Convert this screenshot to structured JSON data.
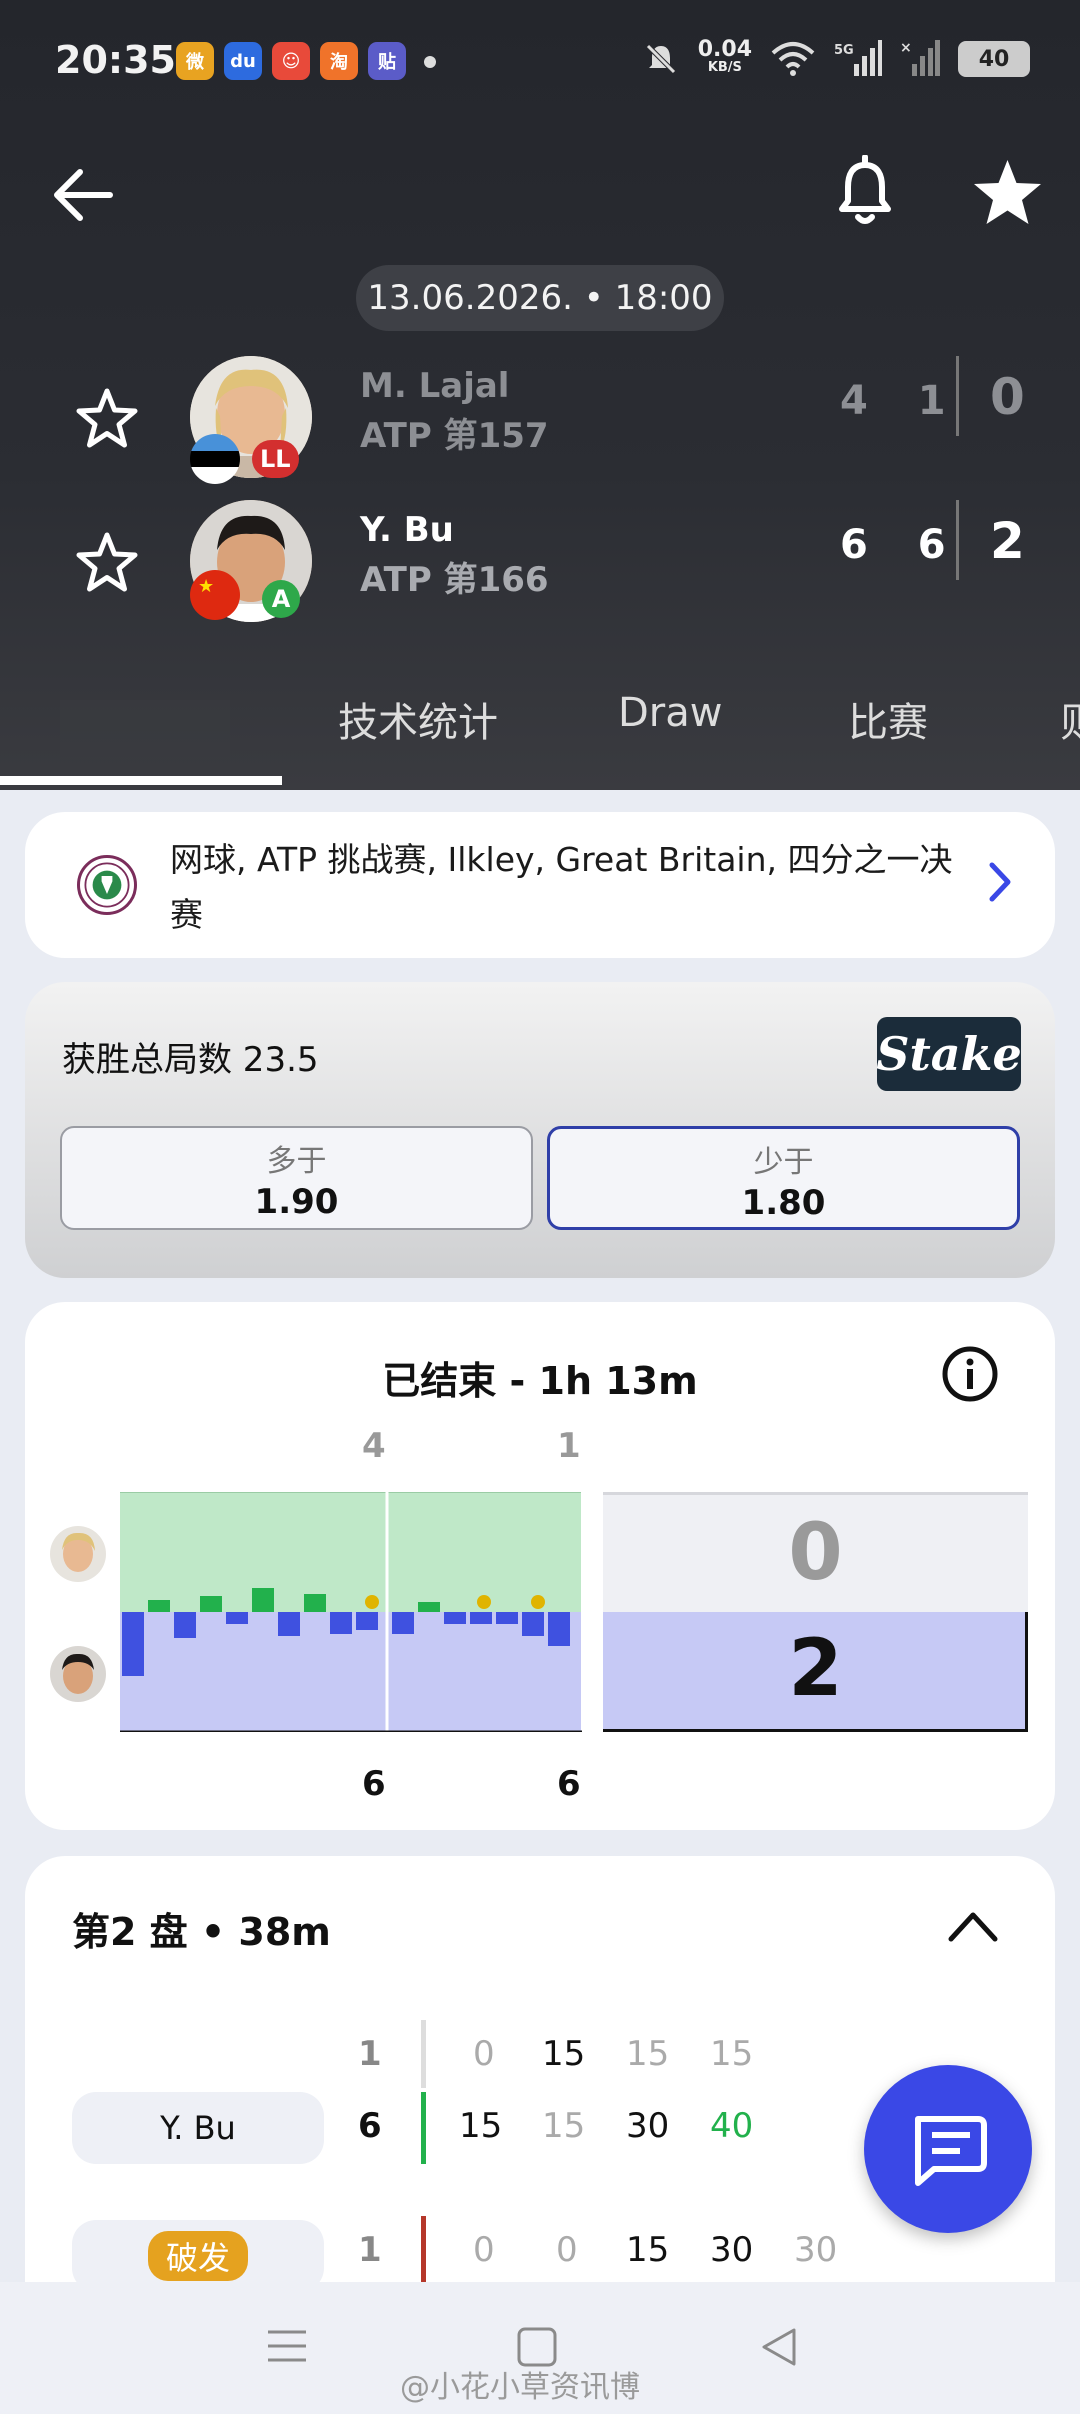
{
  "status_bar": {
    "time": "20:35",
    "speed_value": "0.04",
    "speed_unit": "KB/S",
    "network": "5G",
    "battery": "40"
  },
  "header": {
    "date_time": "13.06.2026. • 18:00",
    "players": [
      {
        "name": "M. Lajal",
        "rank": "ATP 第157",
        "tag": "LL",
        "games": "4 1",
        "sets": "0",
        "flag": "estonia",
        "tag_color": "#d32f2f"
      },
      {
        "name": "Y. Bu",
        "rank": "ATP 第166",
        "tag": "A",
        "games": "6 6",
        "sets": "2",
        "flag": "china",
        "tag_color": "#2ea84a"
      }
    ],
    "tabs": [
      "技术统计",
      "Draw",
      "比赛",
      "则"
    ]
  },
  "tournament": {
    "text": "网球, ATP 挑战赛, Ilkley, Great Britain, 四分之一决赛"
  },
  "bet": {
    "title": "获胜总局数 23.5",
    "brand": "Stake",
    "over_label": "多于",
    "over_value": "1.90",
    "under_label": "少于",
    "under_value": "1.80"
  },
  "summary": {
    "title": "已结束 - 1h 13m",
    "set_top_scores": [
      "4",
      "1"
    ],
    "set_bottom_scores": [
      "6",
      "6"
    ],
    "sets_won_top": "0",
    "sets_won_bottom": "2",
    "colors": {
      "top": "#bfe8c8",
      "bottom": "#c6c9f5",
      "top_bar": "#22b14c",
      "bottom_bar": "#3f51e0"
    }
  },
  "set2": {
    "title": "第2 盘 • 38m",
    "row1": {
      "label": "Y. Bu",
      "games_top": "1",
      "games": "6",
      "points_top": [
        "0",
        "15",
        "15",
        "15"
      ],
      "points": [
        "15",
        "15",
        "30",
        "40"
      ]
    },
    "row2": {
      "label": "破发",
      "games": "1",
      "points": [
        "0",
        "0",
        "15",
        "30",
        "30"
      ]
    }
  },
  "watermark": "@小花小草资讯博"
}
